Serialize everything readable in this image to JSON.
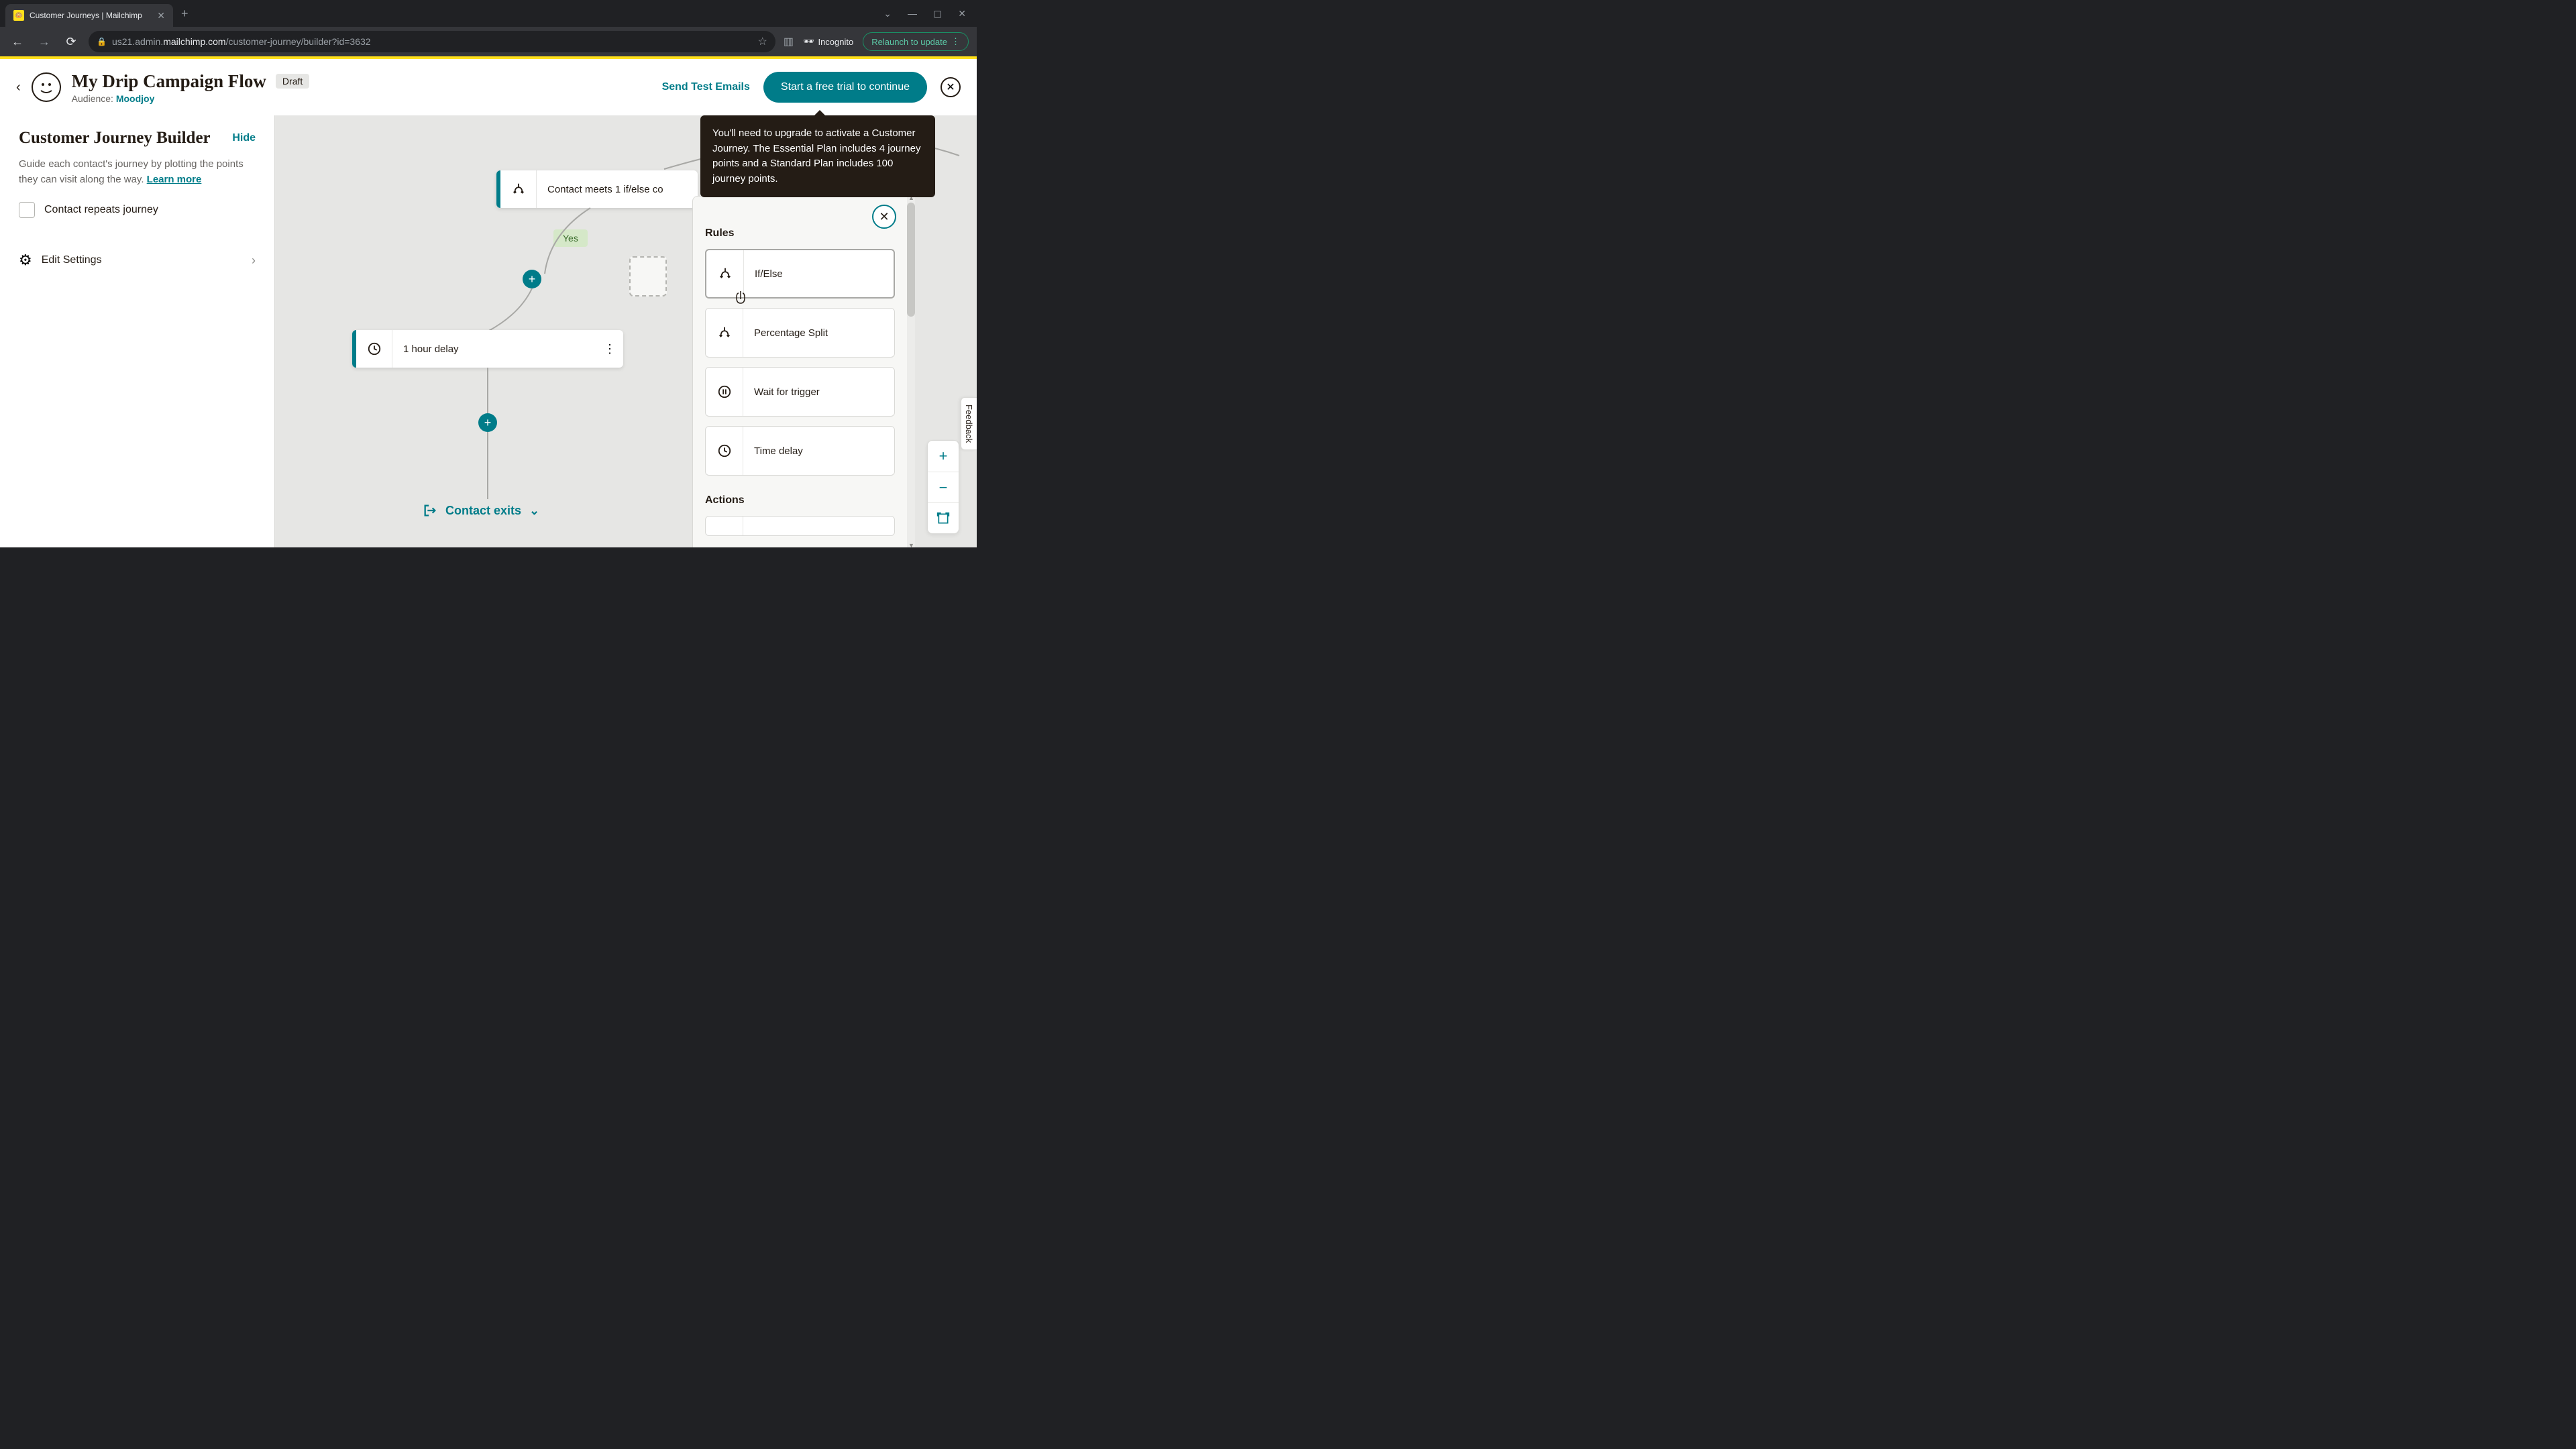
{
  "browser": {
    "tab_title": "Customer Journeys | Mailchimp",
    "url_prefix": "us21.admin.",
    "url_domain": "mailchimp.com",
    "url_path": "/customer-journey/builder?id=3632",
    "incognito": "Incognito",
    "relaunch": "Relaunch to update"
  },
  "header": {
    "title": "My Drip Campaign Flow",
    "status": "Draft",
    "audience_label": "Audience: ",
    "audience_name": "Moodjoy",
    "send_test": "Send Test Emails",
    "cta": "Start a free trial to continue"
  },
  "tooltip": {
    "text": "You'll need to upgrade to activate a Customer Journey. The Essential Plan includes 4 journey points and a Standard Plan includes 100 journey points."
  },
  "sidebar": {
    "title": "Customer Journey Builder",
    "hide": "Hide",
    "desc": "Guide each contact's journey by plotting the points they can visit along the way. ",
    "learn_more": "Learn more",
    "checkbox_label": "Contact repeats journey",
    "settings": "Edit Settings"
  },
  "canvas": {
    "ifelse_text": "Contact meets 1 if/else co",
    "yes": "Yes",
    "delay_text": "1 hour delay",
    "exit": "Contact exits"
  },
  "panel": {
    "rules_heading": "Rules",
    "actions_heading": "Actions",
    "items": {
      "ifelse": "If/Else",
      "percentage": "Percentage Split",
      "wait": "Wait for trigger",
      "time": "Time delay"
    }
  },
  "feedback": "Feedback"
}
